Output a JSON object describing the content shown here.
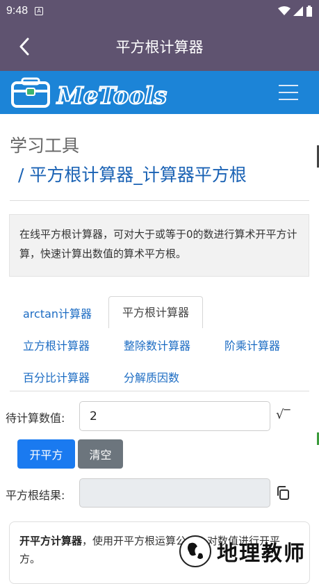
{
  "status": {
    "time": "9:48",
    "notif": "A"
  },
  "appbar": {
    "title": "平方根计算器"
  },
  "brand": {
    "name": "MeTools",
    "color": "#1c84d7"
  },
  "breadcrumb": {
    "section": "学习工具",
    "page": "/ 平方根计算器_计算器平方根"
  },
  "description": "在线平方根计算器，可对大于或等于0的数进行算术开平方计算，快速计算出数值的算术平方根。",
  "tabs": [
    {
      "label": "arctan计算器",
      "active": false
    },
    {
      "label": "平方根计算器",
      "active": true
    },
    {
      "label": "立方根计算器",
      "active": false
    },
    {
      "label": "整除数计算器",
      "active": false
    },
    {
      "label": "阶乘计算器",
      "active": false
    },
    {
      "label": "百分比计算器",
      "active": false
    },
    {
      "label": "分解质因数",
      "active": false
    }
  ],
  "form": {
    "input_label": "待计算数值:",
    "input_value": "2",
    "sqrt_symbol": "√‾",
    "compute_label": "开平方",
    "clear_label": "清空",
    "result_label": "平方根结果:",
    "result_value": ""
  },
  "card": {
    "title": "开平方计算器",
    "text": "，使用开平方根运算公式，对数值进行开平方。"
  },
  "watermark": {
    "text": "地理教师"
  },
  "colors": {
    "appbar": "#5f5370",
    "link": "#1c6cc3",
    "primary": "#1a7af0",
    "secondary": "#6c757d"
  }
}
